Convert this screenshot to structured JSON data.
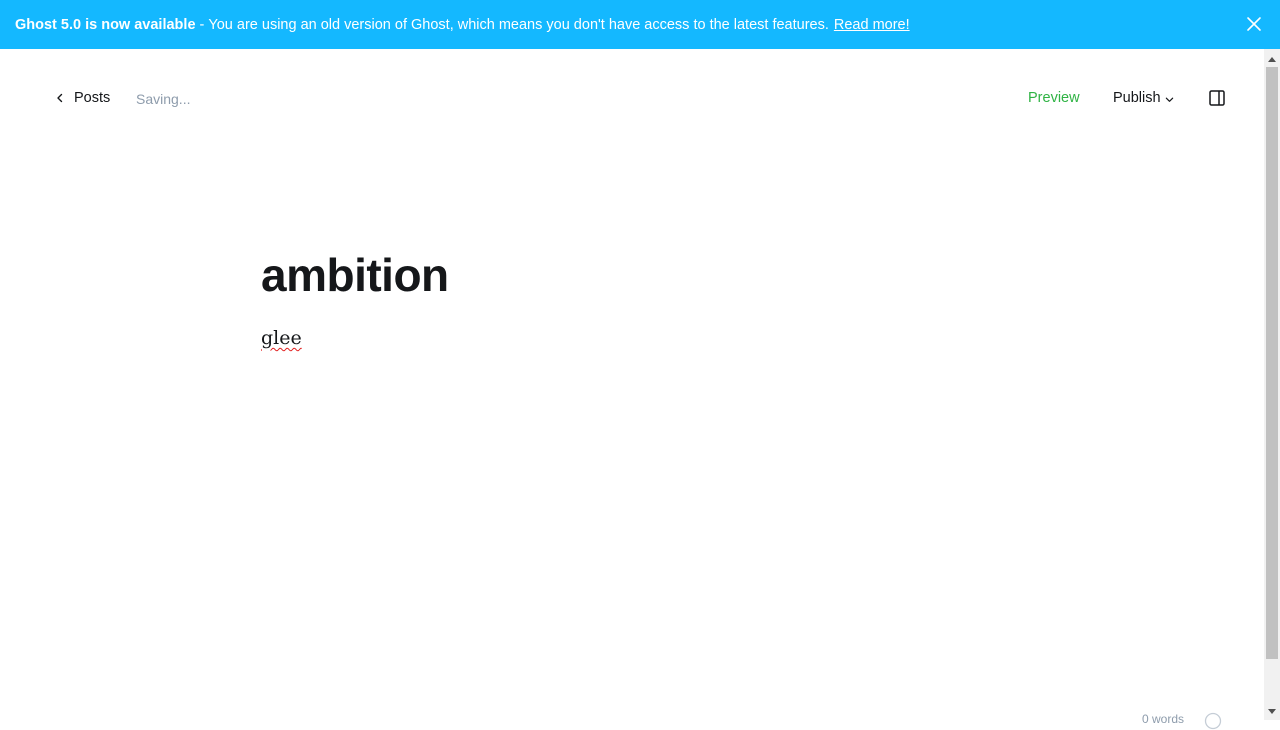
{
  "banner": {
    "headline": "Ghost 5.0 is now available",
    "separator": " - ",
    "message": "You are using an old version of Ghost, which means you don't have access to the latest features.",
    "link_label": "Read more!",
    "close_icon": "close-icon",
    "color": "#14b8ff"
  },
  "header": {
    "back_label": "Posts",
    "back_icon": "chevron-left-icon",
    "status": "Saving...",
    "preview_label": "Preview",
    "publish_label": "Publish",
    "publish_icon": "chevron-down-icon",
    "settings_icon": "sidebar-toggle-icon",
    "accent_color": "#2fb344"
  },
  "post": {
    "title": "ambition",
    "body": "glee"
  },
  "footer": {
    "word_count": "0 words",
    "help_icon": "help-icon"
  }
}
